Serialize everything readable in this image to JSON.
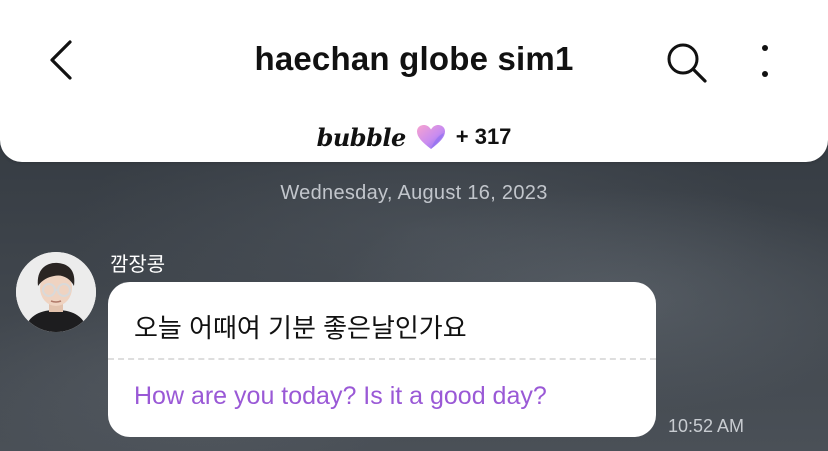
{
  "header": {
    "title": "haechan globe sim1",
    "bubble_logo": "bubble",
    "bubble_count": "+ 317",
    "icons": {
      "back": "chevron-left-icon",
      "search": "search-icon",
      "more": "more-vertical-icon",
      "heart": "heart-icon"
    }
  },
  "chat": {
    "date": "Wednesday, August 16, 2023",
    "messages": [
      {
        "sender": "깜장콩",
        "text": "오늘 어때여 기분 좋은날인가요",
        "translation": "How are you today? Is it a good day?",
        "time": "10:52 AM"
      }
    ]
  },
  "colors": {
    "translation": "#9a59d6",
    "heart_pink": "#f3a6d6",
    "heart_purple": "#8a6ef0"
  }
}
